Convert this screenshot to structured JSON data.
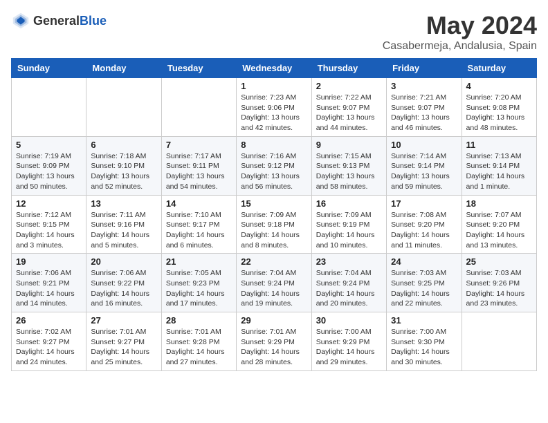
{
  "header": {
    "logo_general": "General",
    "logo_blue": "Blue",
    "title": "May 2024",
    "subtitle": "Casabermeja, Andalusia, Spain"
  },
  "weekdays": [
    "Sunday",
    "Monday",
    "Tuesday",
    "Wednesday",
    "Thursday",
    "Friday",
    "Saturday"
  ],
  "weeks": [
    [
      {
        "day": "",
        "info": ""
      },
      {
        "day": "",
        "info": ""
      },
      {
        "day": "",
        "info": ""
      },
      {
        "day": "1",
        "info": "Sunrise: 7:23 AM\nSunset: 9:06 PM\nDaylight: 13 hours\nand 42 minutes."
      },
      {
        "day": "2",
        "info": "Sunrise: 7:22 AM\nSunset: 9:07 PM\nDaylight: 13 hours\nand 44 minutes."
      },
      {
        "day": "3",
        "info": "Sunrise: 7:21 AM\nSunset: 9:07 PM\nDaylight: 13 hours\nand 46 minutes."
      },
      {
        "day": "4",
        "info": "Sunrise: 7:20 AM\nSunset: 9:08 PM\nDaylight: 13 hours\nand 48 minutes."
      }
    ],
    [
      {
        "day": "5",
        "info": "Sunrise: 7:19 AM\nSunset: 9:09 PM\nDaylight: 13 hours\nand 50 minutes."
      },
      {
        "day": "6",
        "info": "Sunrise: 7:18 AM\nSunset: 9:10 PM\nDaylight: 13 hours\nand 52 minutes."
      },
      {
        "day": "7",
        "info": "Sunrise: 7:17 AM\nSunset: 9:11 PM\nDaylight: 13 hours\nand 54 minutes."
      },
      {
        "day": "8",
        "info": "Sunrise: 7:16 AM\nSunset: 9:12 PM\nDaylight: 13 hours\nand 56 minutes."
      },
      {
        "day": "9",
        "info": "Sunrise: 7:15 AM\nSunset: 9:13 PM\nDaylight: 13 hours\nand 58 minutes."
      },
      {
        "day": "10",
        "info": "Sunrise: 7:14 AM\nSunset: 9:14 PM\nDaylight: 13 hours\nand 59 minutes."
      },
      {
        "day": "11",
        "info": "Sunrise: 7:13 AM\nSunset: 9:14 PM\nDaylight: 14 hours\nand 1 minute."
      }
    ],
    [
      {
        "day": "12",
        "info": "Sunrise: 7:12 AM\nSunset: 9:15 PM\nDaylight: 14 hours\nand 3 minutes."
      },
      {
        "day": "13",
        "info": "Sunrise: 7:11 AM\nSunset: 9:16 PM\nDaylight: 14 hours\nand 5 minutes."
      },
      {
        "day": "14",
        "info": "Sunrise: 7:10 AM\nSunset: 9:17 PM\nDaylight: 14 hours\nand 6 minutes."
      },
      {
        "day": "15",
        "info": "Sunrise: 7:09 AM\nSunset: 9:18 PM\nDaylight: 14 hours\nand 8 minutes."
      },
      {
        "day": "16",
        "info": "Sunrise: 7:09 AM\nSunset: 9:19 PM\nDaylight: 14 hours\nand 10 minutes."
      },
      {
        "day": "17",
        "info": "Sunrise: 7:08 AM\nSunset: 9:20 PM\nDaylight: 14 hours\nand 11 minutes."
      },
      {
        "day": "18",
        "info": "Sunrise: 7:07 AM\nSunset: 9:20 PM\nDaylight: 14 hours\nand 13 minutes."
      }
    ],
    [
      {
        "day": "19",
        "info": "Sunrise: 7:06 AM\nSunset: 9:21 PM\nDaylight: 14 hours\nand 14 minutes."
      },
      {
        "day": "20",
        "info": "Sunrise: 7:06 AM\nSunset: 9:22 PM\nDaylight: 14 hours\nand 16 minutes."
      },
      {
        "day": "21",
        "info": "Sunrise: 7:05 AM\nSunset: 9:23 PM\nDaylight: 14 hours\nand 17 minutes."
      },
      {
        "day": "22",
        "info": "Sunrise: 7:04 AM\nSunset: 9:24 PM\nDaylight: 14 hours\nand 19 minutes."
      },
      {
        "day": "23",
        "info": "Sunrise: 7:04 AM\nSunset: 9:24 PM\nDaylight: 14 hours\nand 20 minutes."
      },
      {
        "day": "24",
        "info": "Sunrise: 7:03 AM\nSunset: 9:25 PM\nDaylight: 14 hours\nand 22 minutes."
      },
      {
        "day": "25",
        "info": "Sunrise: 7:03 AM\nSunset: 9:26 PM\nDaylight: 14 hours\nand 23 minutes."
      }
    ],
    [
      {
        "day": "26",
        "info": "Sunrise: 7:02 AM\nSunset: 9:27 PM\nDaylight: 14 hours\nand 24 minutes."
      },
      {
        "day": "27",
        "info": "Sunrise: 7:01 AM\nSunset: 9:27 PM\nDaylight: 14 hours\nand 25 minutes."
      },
      {
        "day": "28",
        "info": "Sunrise: 7:01 AM\nSunset: 9:28 PM\nDaylight: 14 hours\nand 27 minutes."
      },
      {
        "day": "29",
        "info": "Sunrise: 7:01 AM\nSunset: 9:29 PM\nDaylight: 14 hours\nand 28 minutes."
      },
      {
        "day": "30",
        "info": "Sunrise: 7:00 AM\nSunset: 9:29 PM\nDaylight: 14 hours\nand 29 minutes."
      },
      {
        "day": "31",
        "info": "Sunrise: 7:00 AM\nSunset: 9:30 PM\nDaylight: 14 hours\nand 30 minutes."
      },
      {
        "day": "",
        "info": ""
      }
    ]
  ]
}
